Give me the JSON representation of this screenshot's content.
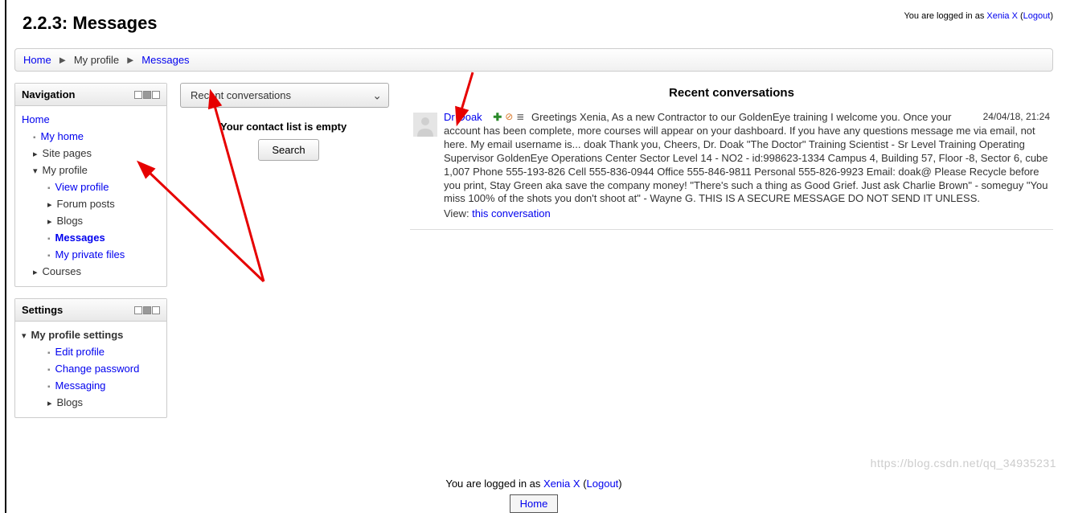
{
  "header": {
    "title": "2.2.3: Messages",
    "login_prefix": "You are logged in as ",
    "user": "Xenia X",
    "logout": "Logout"
  },
  "breadcrumbs": {
    "home": "Home",
    "profile": "My profile",
    "messages": "Messages"
  },
  "nav_block": {
    "title": "Navigation",
    "items": {
      "home": "Home",
      "my_home": "My home",
      "site_pages": "Site pages",
      "my_profile": "My profile",
      "view_profile": "View profile",
      "forum_posts": "Forum posts",
      "blogs": "Blogs",
      "messages": "Messages",
      "my_private_files": "My private files",
      "courses": "Courses"
    }
  },
  "settings_block": {
    "title": "Settings",
    "root": "My profile settings",
    "items": {
      "edit_profile": "Edit profile",
      "change_password": "Change password",
      "messaging": "Messaging",
      "blogs": "Blogs"
    }
  },
  "mid": {
    "dropdown_selected": "Recent conversations",
    "empty_text": "Your contact list is empty",
    "search_label": "Search"
  },
  "right": {
    "heading": "Recent conversations",
    "sender": "Dr Doak",
    "time": "24/04/18, 21:24",
    "body": "Greetings Xenia, As a new Contractor to our GoldenEye training I welcome you. Once your account has been complete, more courses will appear on your dashboard. If you have any questions message me via email, not here. My email username is... doak Thank you, Cheers, Dr. Doak \"The Doctor\" Training Scientist - Sr Level Training Operating Supervisor GoldenEye Operations Center Sector Level 14 - NO2 - id:998623-1334 Campus 4, Building 57, Floor -8, Sector 6, cube 1,007 Phone 555-193-826 Cell 555-836-0944 Office 555-846-9811 Personal 555-826-9923 Email: doak@ Please Recycle before you print, Stay Green aka save the company money! \"There's such a thing as Good Grief. Just ask Charlie Brown\" - someguy \"You miss 100% of the shots you don't shoot at\" - Wayne G. THIS IS A SECURE MESSAGE DO NOT SEND IT UNLESS.",
    "view_prefix": "View: ",
    "view_link": "this conversation"
  },
  "footer": {
    "login_prefix": "You are logged in as ",
    "user": "Xenia X",
    "logout": "Logout",
    "home": "Home"
  },
  "watermark": "https://blog.csdn.net/qq_34935231"
}
